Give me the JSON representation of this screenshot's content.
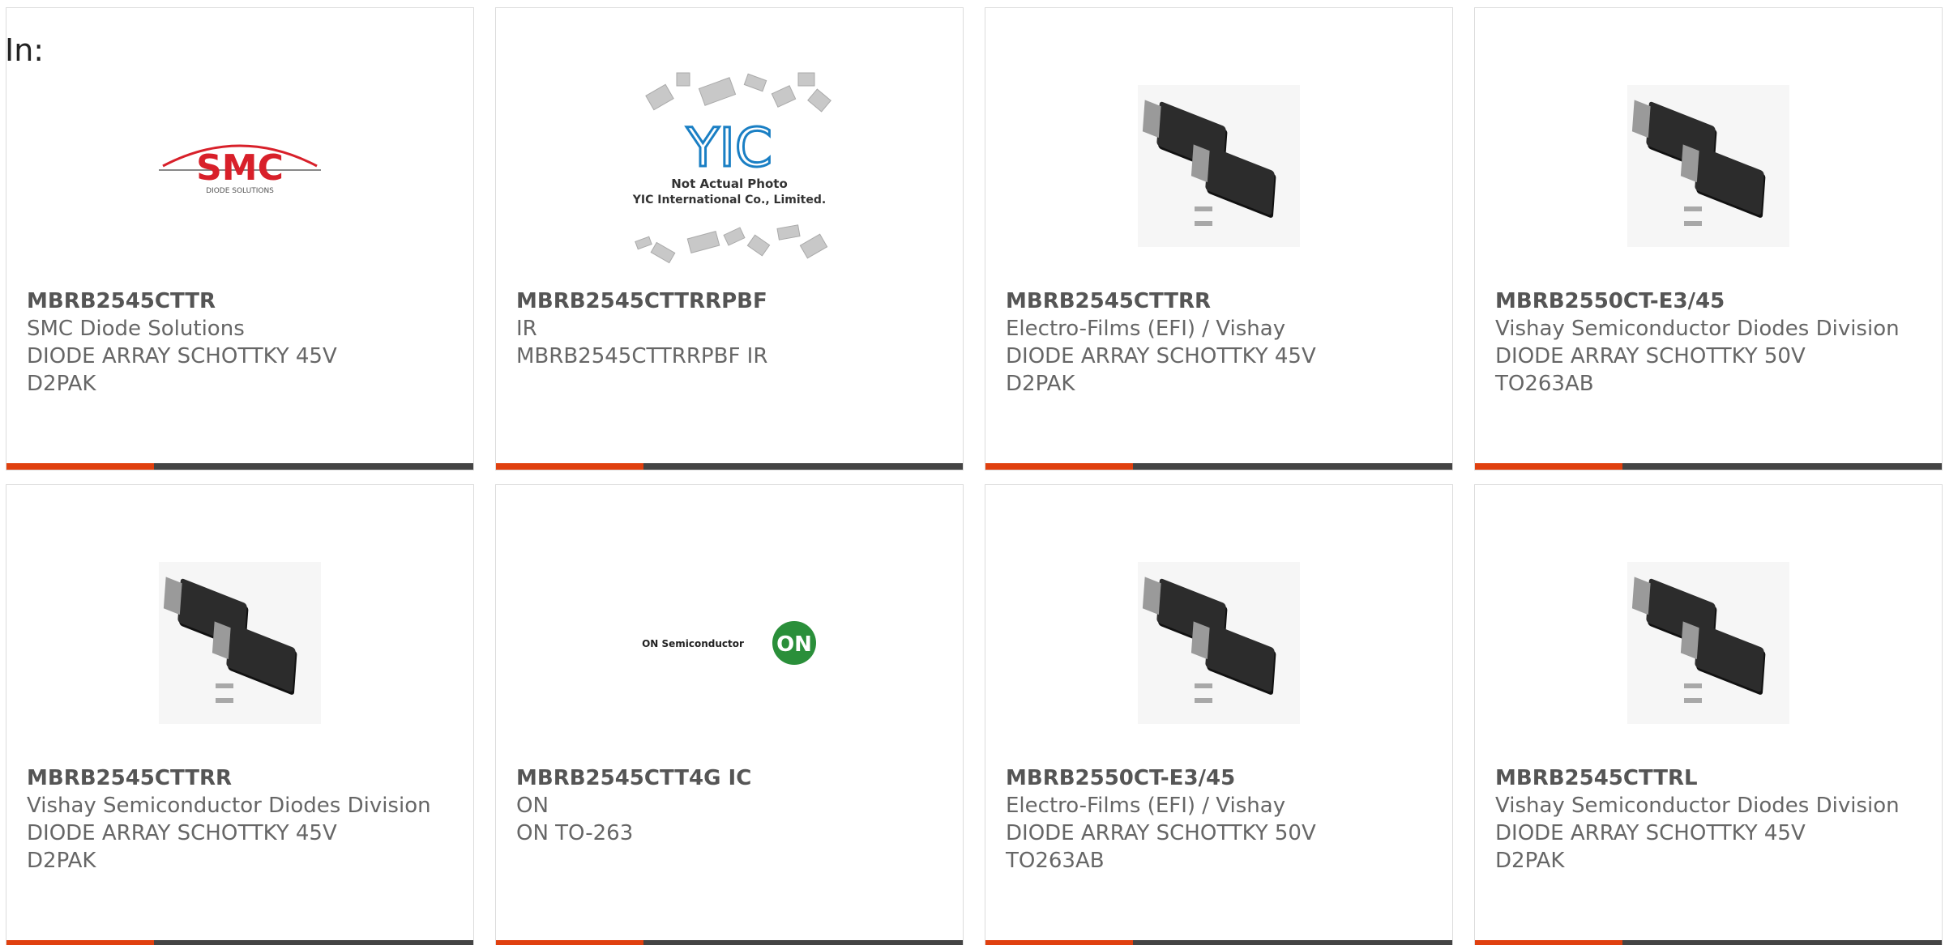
{
  "page": {
    "in_label": "In:"
  },
  "cards": [
    {
      "part": "MBRB2545CTTR",
      "manufacturer": "SMC Diode Solutions",
      "desc": "DIODE ARRAY SCHOTTKY 45V D2PAK",
      "image": "smc-logo",
      "logo_text": "SMC",
      "logo_sub": "DIODE SOLUTIONS"
    },
    {
      "part": "MBRB2545CTTRRPBF",
      "manufacturer": "IR",
      "desc": "MBRB2545CTTRRPBF IR",
      "image": "yic-placeholder",
      "logo_text": "YIC",
      "logo_sub1": "Not Actual Photo",
      "logo_sub2": "YIC International Co., Limited."
    },
    {
      "part": "MBRB2545CTTRR",
      "manufacturer": "Electro-Films (EFI) / Vishay",
      "desc": "DIODE ARRAY SCHOTTKY 45V D2PAK",
      "image": "d2pak-photo"
    },
    {
      "part": "MBRB2550CT-E3/45",
      "manufacturer": "Vishay Semiconductor Diodes Division",
      "desc": "DIODE ARRAY SCHOTTKY 50V TO263AB",
      "image": "d2pak-photo"
    },
    {
      "part": "MBRB2545CTTRR",
      "manufacturer": "Vishay Semiconductor Diodes Division",
      "desc": "DIODE ARRAY SCHOTTKY 45V D2PAK",
      "image": "d2pak-photo"
    },
    {
      "part": "MBRB2545CTT4G IC",
      "manufacturer": "ON",
      "desc": "ON TO-263",
      "image": "on-logo",
      "logo_text": "ON Semiconductor",
      "logo_badge": "ON"
    },
    {
      "part": "MBRB2550CT-E3/45",
      "manufacturer": "Electro-Films (EFI) / Vishay",
      "desc": "DIODE ARRAY SCHOTTKY 50V TO263AB",
      "image": "d2pak-photo"
    },
    {
      "part": "MBRB2545CTTRL",
      "manufacturer": "Vishay Semiconductor Diodes Division",
      "desc": "DIODE ARRAY SCHOTTKY 45V D2PAK",
      "image": "d2pak-photo"
    }
  ],
  "colors": {
    "accent": "#e0400f",
    "bar": "#444444",
    "border": "#dcdcdc",
    "smc_red": "#d8202a",
    "yic_blue": "#1a7fc4",
    "on_green": "#2a8f3a"
  }
}
